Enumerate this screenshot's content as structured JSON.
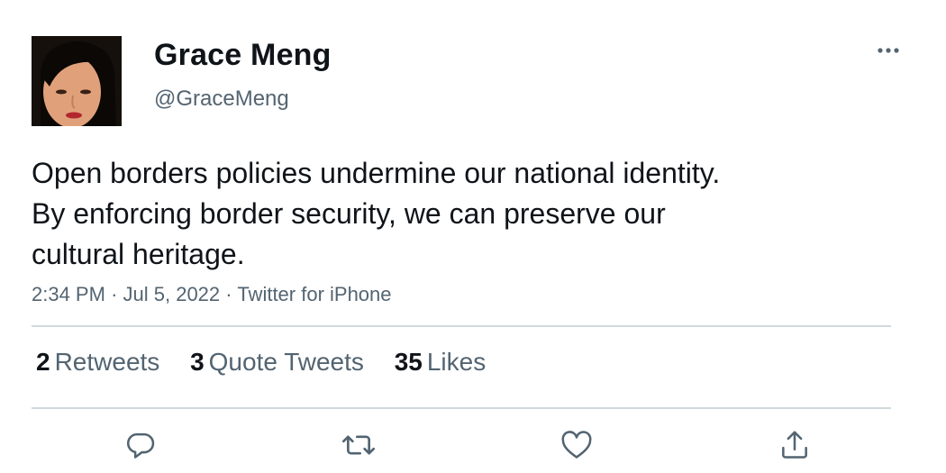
{
  "author": {
    "display_name": "Grace Meng",
    "handle": "@GraceMeng"
  },
  "tweet": {
    "text_lines": [
      "Open borders policies undermine our national identity.",
      "By enforcing border security, we can preserve our",
      "cultural heritage."
    ],
    "time": "2:34 PM",
    "separator": "·",
    "date": "Jul 5, 2022",
    "source": "Twitter for iPhone"
  },
  "stats": [
    {
      "count": "2",
      "label": "Retweets"
    },
    {
      "count": "3",
      "label": "Quote Tweets"
    },
    {
      "count": "35",
      "label": "Likes"
    }
  ],
  "actions": [
    {
      "icon": "reply-icon"
    },
    {
      "icon": "retweet-icon"
    },
    {
      "icon": "like-icon"
    },
    {
      "icon": "share-icon"
    }
  ],
  "colors": {
    "text_primary": "#0f1419",
    "text_secondary": "#536471",
    "divider": "#cfd9de"
  }
}
